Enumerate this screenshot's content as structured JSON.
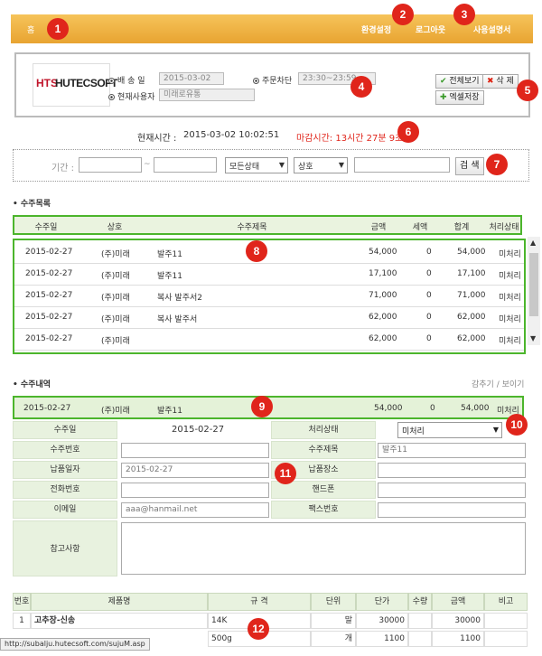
{
  "topbar": {
    "home": "홈",
    "menu": [
      "환경설정",
      "로그아웃",
      "사용설명서"
    ]
  },
  "info": {
    "delivery_date_label": "배 송 일",
    "delivery_date": "2015-03-02",
    "cutoff_label": "주문차단",
    "cutoff_time": "23:30~23:59",
    "user_label": "현재사용자",
    "user": "미래로유통",
    "buttons": {
      "view_all": "전체보기",
      "delete": "삭 제",
      "excel": "엑셀저장"
    }
  },
  "logo": {
    "part1": "HTS",
    "part2": "HUTECSOFT"
  },
  "clock": {
    "now_label": "현재시간 :",
    "now": "2015-03-02 10:02:51",
    "deadline": "마감시간: 13시간 27분 9초"
  },
  "search": {
    "period_label": "기간 :",
    "tilde": "~",
    "status": "모든상태",
    "company": "상호",
    "button": "검 색"
  },
  "orders": {
    "title": "• 수주목록",
    "columns": [
      "수주일",
      "상호",
      "수주제목",
      "금액",
      "세액",
      "합계",
      "처리상태"
    ],
    "rows": [
      [
        "2015-02-27",
        "(주)미래",
        "발주11",
        "54,000",
        "0",
        "54,000",
        "미처리"
      ],
      [
        "2015-02-27",
        "(주)미래",
        "발주11",
        "17,100",
        "0",
        "17,100",
        "미처리"
      ],
      [
        "2015-02-27",
        "(주)미래",
        "복사 발주서2",
        "71,000",
        "0",
        "71,000",
        "미처리"
      ],
      [
        "2015-02-27",
        "(주)미래",
        "복사 발주서",
        "62,000",
        "0",
        "62,000",
        "미처리"
      ],
      [
        "2015-02-27",
        "(주)미래",
        "",
        "62,000",
        "0",
        "62,000",
        "미처리"
      ]
    ]
  },
  "detail": {
    "title": "• 수주내역",
    "toggle": "감추기 / 보이기",
    "selected": [
      "2015-02-27",
      "(주)미래",
      "발주11",
      "54,000",
      "0",
      "54,000",
      "미처리"
    ],
    "order_date_label": "수주일",
    "order_date": "2015-02-27",
    "status_label": "처리상태",
    "status_value": "미처리",
    "order_no_label": "수주번호",
    "order_title_label": "수주제목",
    "order_title": "발주11",
    "due_label": "납품일자",
    "due": "2015-02-27",
    "place_label": "납품장소",
    "phone_label": "전화번호",
    "mobile_label": "핸드폰",
    "email_label": "이메일",
    "email": "aaa@hanmail.net",
    "fax_label": "팩스번호",
    "note_label": "참고사항"
  },
  "items": {
    "columns": [
      "번호",
      "제품명",
      "규 격",
      "단위",
      "단가",
      "수량",
      "금액",
      "비고"
    ],
    "rows": [
      [
        "1",
        "고추장-신송",
        "14K",
        "말",
        "30000",
        "",
        "30000",
        ""
      ],
      [
        "",
        "",
        "500g",
        "개",
        "1100",
        "",
        "1100",
        ""
      ]
    ]
  },
  "statusbar": "http://subalju.hutecsoft.com/sujuM.asp",
  "badges": [
    "1",
    "2",
    "3",
    "4",
    "5",
    "6",
    "7",
    "8",
    "9",
    "10",
    "11",
    "12"
  ]
}
